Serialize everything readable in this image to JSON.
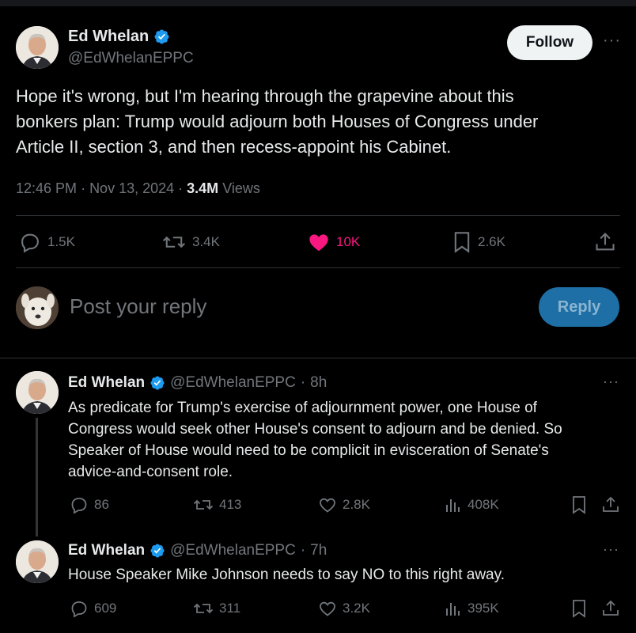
{
  "main": {
    "author_name": "Ed Whelan",
    "author_handle": "@EdWhelanEPPC",
    "follow_label": "Follow",
    "more_label": "···",
    "text_lines": [
      "Hope it's wrong, but I'm hearing through the grapevine about this",
      "bonkers plan: Trump would adjourn both Houses of Congress under",
      "Article II, section 3, and then recess-appoint his Cabinet."
    ],
    "time": "12:46 PM",
    "date": "Nov 13, 2024",
    "views_count": "3.4M",
    "views_label": "Views",
    "replies": "1.5K",
    "reposts": "3.4K",
    "likes": "10K",
    "bookmarks": "2.6K"
  },
  "composer": {
    "placeholder": "Post your reply",
    "reply_label": "Reply"
  },
  "replies": [
    {
      "name": "Ed Whelan",
      "handle": "@EdWhelanEPPC",
      "age": "8h",
      "text_lines": [
        "As predicate for Trump's exercise of adjournment power, one House of",
        "Congress would seek other House's consent to adjourn and be denied. So",
        "Speaker of House would need to be complicit in evisceration of Senate's",
        "advice-and-consent role."
      ],
      "replies": "86",
      "reposts": "413",
      "likes": "2.8K",
      "views": "408K"
    },
    {
      "name": "Ed Whelan",
      "handle": "@EdWhelanEPPC",
      "age": "7h",
      "text_lines": [
        "House Speaker Mike Johnson needs to say NO to this right away."
      ],
      "replies": "609",
      "reposts": "311",
      "likes": "3.2K",
      "views": "395K"
    }
  ],
  "colors": {
    "background": "#000000",
    "text": "#e7e9ea",
    "muted": "#71767b",
    "verified": "#1d9bf0",
    "like_active": "#f91880",
    "reply_button": "#1d6fa5"
  },
  "icons": [
    "verified-badge-icon",
    "reply-icon",
    "repost-icon",
    "heart-icon",
    "bookmark-icon",
    "share-icon",
    "views-icon",
    "more-icon"
  ]
}
